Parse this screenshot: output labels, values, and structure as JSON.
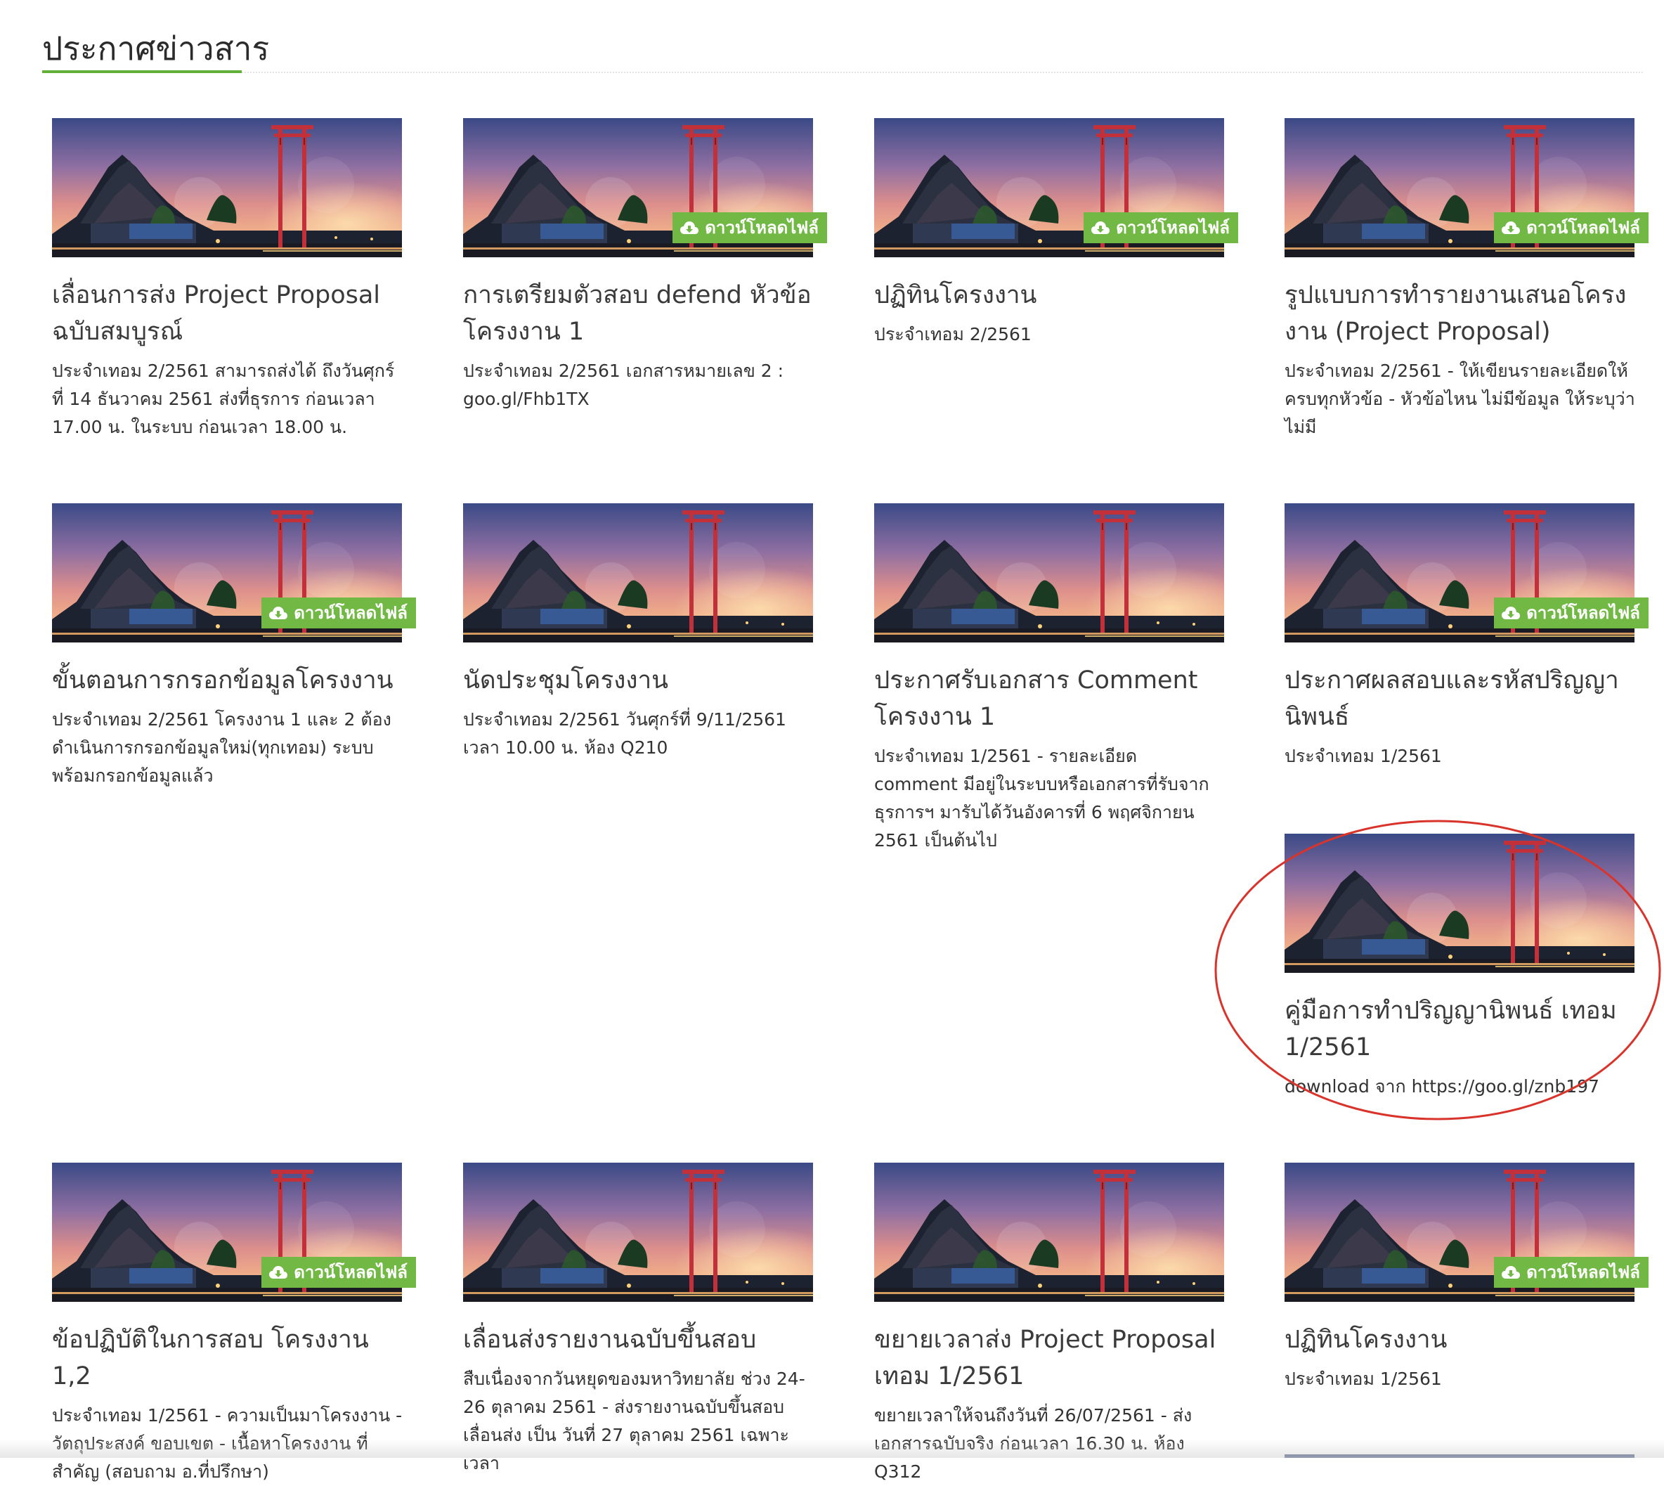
{
  "page": {
    "title": "ประกาศข่าวสาร"
  },
  "colors": {
    "accent": "#62b038",
    "badge": "#72b844",
    "highlight_circle": "#d9342b"
  },
  "download_label": "ดาวน์โหลดไฟล์",
  "download_icon": "cloud-download-icon",
  "posts": [
    {
      "title": "เลื่อนการส่ง Project Proposal ฉบับสมบูรณ์",
      "description": "ประจำเทอม 2/2561 สามารถส่งได้ ถึงวันศุกร์ที่ 14 ธันวาคม 2561 ส่งที่ธุรการ ก่อนเวลา 17.00 น. ในระบบ ก่อนเวลา 18.00 น.",
      "has_download": false
    },
    {
      "title": "การเตรียมตัวสอบ defend หัวข้อโครงงาน 1",
      "description": "ประจำเทอม 2/2561 เอกสารหมายเลข 2 : goo.gl/Fhb1TX",
      "has_download": true
    },
    {
      "title": "ปฏิทินโครงงาน",
      "description": "ประจำเทอม 2/2561",
      "has_download": true
    },
    {
      "title": "รูปแบบการทำรายงานเสนอโครงงาน (Project Proposal)",
      "description": "ประจำเทอม 2/2561 - ให้เขียนรายละเอียดให้ครบทุกหัวข้อ - หัวข้อไหน ไม่มีข้อมูล ให้ระบุว่าไม่มี",
      "has_download": true
    },
    {
      "title": "ขั้นตอนการกรอกข้อมูลโครงงาน",
      "description": "ประจำเทอม 2/2561 โครงงาน 1 และ 2 ต้องดำเนินการกรอกข้อมูลใหม่(ทุกเทอม) ระบบพร้อมกรอกข้อมูลแล้ว",
      "has_download": true
    },
    {
      "title": "นัดประชุมโครงงาน",
      "description": "ประจำเทอม 2/2561 วันศุกร์ที่ 9/11/2561 เวลา 10.00 น. ห้อง Q210",
      "has_download": false
    },
    {
      "title": "ประกาศรับเอกสาร Comment โครงงาน 1",
      "description": "ประจำเทอม 1/2561 - รายละเอียด comment มีอยู่ในระบบหรือเอกสารที่รับจากธุรการฯ มารับได้วันอังคารที่ 6 พฤศจิกายน 2561 เป็นต้นไป",
      "has_download": false
    },
    {
      "title": "ประกาศผลสอบและรหัสปริญญานิพนธ์",
      "description": "ประจำเทอม 1/2561",
      "has_download": true
    },
    {
      "title": "คู่มือการทำปริญญานิพนธ์ เทอม 1/2561",
      "description": "download จาก https://goo.gl/znb197",
      "has_download": false
    },
    {
      "title": "ข้อปฏิบัติในการสอบ โครงงาน 1,2",
      "description": "ประจำเทอม 1/2561 - ความเป็นมาโครงงาน - วัตถุประสงค์ ขอบเขต - เนื้อหาโครงงาน ที่สำคัญ (สอบถาม อ.ที่ปรึกษา)",
      "has_download": true
    },
    {
      "title": "เลื่อนส่งรายงานฉบับขึ้นสอบ",
      "description": "สืบเนื่องจากวันหยุดของมหาวิทยาลัย ช่วง 24-26 ตุลาคม 2561 - ส่งรายงานฉบับขึ้นสอบเลื่อนส่ง เป็น วันที่ 27 ตุลาคม 2561 เฉพาะเวลา",
      "has_download": false
    },
    {
      "title": "ขยายเวลาส่ง Project Proposal เทอม 1/2561",
      "description": "ขยายเวลาให้จนถึงวันที่ 26/07/2561 - ส่งเอกสารฉบับจริง ก่อนเวลา 16.30 น. ห้อง Q312",
      "has_download": false
    },
    {
      "title": "ปฏิทินโครงงาน",
      "description": "ประจำเทอม 1/2561",
      "has_download": true
    }
  ]
}
